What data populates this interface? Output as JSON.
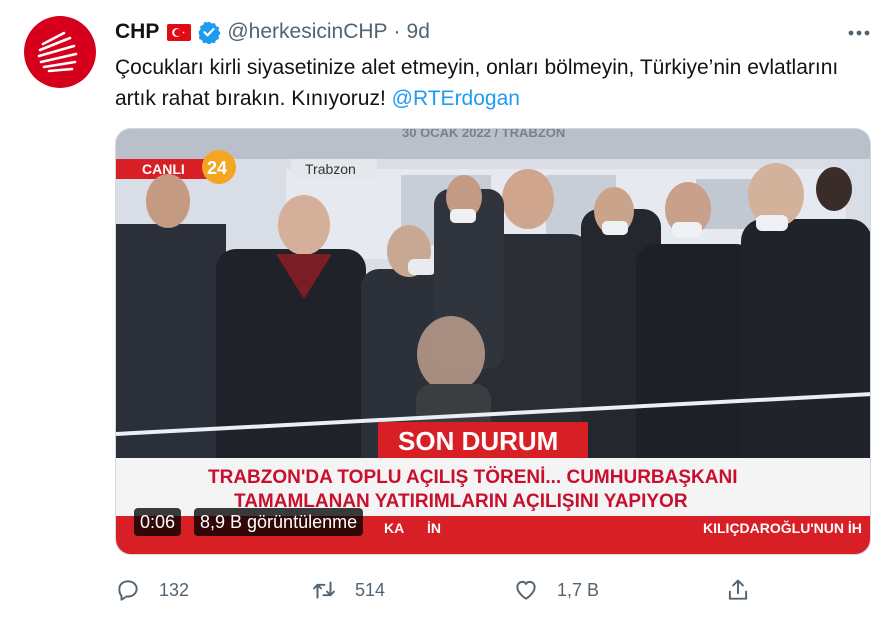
{
  "tweet": {
    "author_name": "CHP",
    "handle": "@herkesicinCHP",
    "separator": "·",
    "time": "9d",
    "text": "Çocukları kirli siyasetinize alet etmeyin, onları bölmeyin, Türkiye’nin evlatlarını artık rahat bırakın. Kınıyoruz! ",
    "mention": "@RTErdogan"
  },
  "video": {
    "duration": "0:06",
    "views": "8,9 B görüntülenme",
    "broadcast": {
      "live_label": "CANLI",
      "channel_number": "24",
      "location": "Trabzon",
      "backdrop_text": "30 OCAK 2022 / TRABZON",
      "banner_title": "SON DURUM",
      "headline_line1": "TRABZON'DA TOPLU AÇILIŞ TÖRENİ... CUMHURBAŞKANI",
      "headline_line2": "TAMAMLANAN YATIRIMLARIN AÇILIŞINI YAPIYOR",
      "ticker_left": "KA",
      "ticker_mid": "İN",
      "ticker_right": "KILIÇDAROĞLU'NUN İH"
    }
  },
  "actions": {
    "replies": "132",
    "retweets": "514",
    "likes": "1,7 B"
  },
  "colors": {
    "accent": "#1d9bf0",
    "brand_red": "#d6001c",
    "muted": "#536471",
    "news_red": "#d91f26"
  },
  "icons": [
    "chp-logo-icon",
    "turkey-flag-icon",
    "verified-badge-icon",
    "more-icon",
    "reply-icon",
    "retweet-icon",
    "like-icon",
    "share-icon"
  ]
}
